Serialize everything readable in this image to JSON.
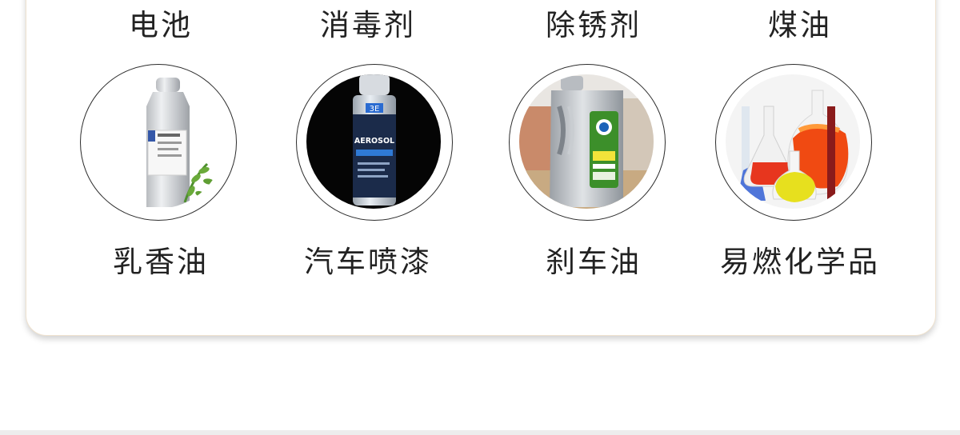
{
  "items": [
    {
      "top_label": "电池",
      "bottom_label": "乳香油",
      "image": "aluminum-bottle-image"
    },
    {
      "top_label": "消毒剂",
      "bottom_label": "汽车喷漆",
      "image": "aerosol-can-image"
    },
    {
      "top_label": "除锈剂",
      "bottom_label": "刹车油",
      "image": "oil-jug-image"
    },
    {
      "top_label": "煤油",
      "bottom_label": "易燃化学品",
      "image": "chemical-flasks-image"
    }
  ],
  "images": {
    "aerosol_text": "AEROSOL",
    "aerosol_badge": "3E"
  },
  "colors": {
    "card_border": "#efe2cf",
    "text": "#222222"
  }
}
